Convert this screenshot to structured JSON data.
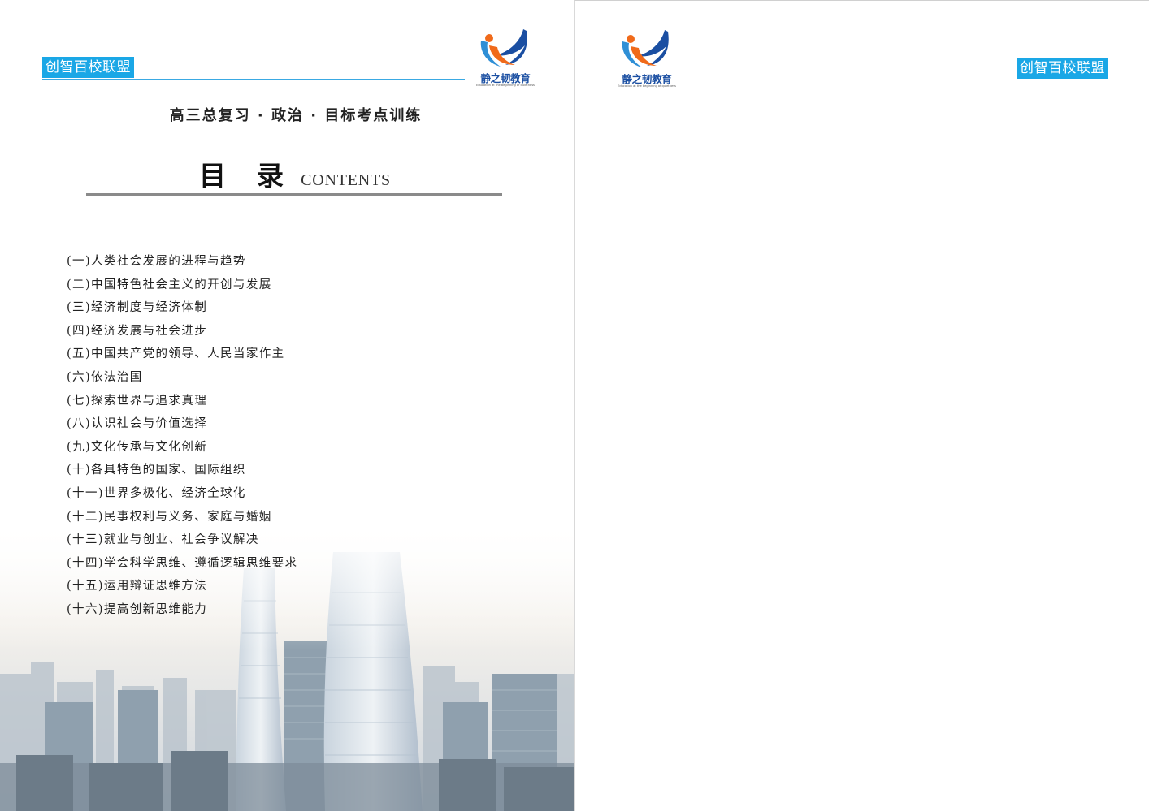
{
  "left_page": {
    "badge": "创智百校联盟",
    "logo": {
      "name": "静之韧教育",
      "tagline": "Education at the beginning of quietness"
    },
    "subtitle": "高三总复习 · 政治 · 目标考点训练",
    "heading": {
      "cn": "目录",
      "en": "CONTENTS"
    },
    "toc": [
      "(一)人类社会发展的进程与趋势",
      "(二)中国特色社会主义的开创与发展",
      "(三)经济制度与经济体制",
      "(四)经济发展与社会进步",
      "(五)中国共产党的领导、人民当家作主",
      "(六)依法治国",
      "(七)探索世界与追求真理",
      "(八)认识社会与价值选择",
      "(九)文化传承与文化创新",
      "(十)各具特色的国家、国际组织",
      "(十一)世界多极化、经济全球化",
      "(十二)民事权利与义务、家庭与婚姻",
      "(十三)就业与创业、社会争议解决",
      "(十四)学会科学思维、遵循逻辑思维要求",
      "(十五)运用辩证思维方法",
      "(十六)提高创新思维能力"
    ]
  },
  "right_page": {
    "badge": "创智百校联盟",
    "logo": {
      "name": "静之韧教育",
      "tagline": "Education at the beginning of quietness"
    }
  },
  "colors": {
    "badge_bg": "#1aa7e6",
    "rule_blue": "#3aa9e3",
    "logo_blue": "#1b4fa2",
    "logo_orange": "#f06a1a"
  }
}
